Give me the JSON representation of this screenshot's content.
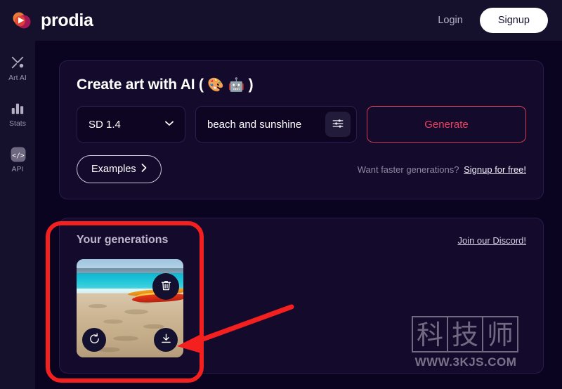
{
  "header": {
    "brand": "prodia",
    "logo_icon": "prodia-play-logo-icon",
    "login_label": "Login",
    "signup_label": "Signup"
  },
  "sidebar": {
    "items": [
      {
        "label": "Art AI",
        "icon": "brush-pen-icon"
      },
      {
        "label": "Stats",
        "icon": "bar-chart-icon"
      },
      {
        "label": "API",
        "icon": "code-brackets-icon"
      }
    ]
  },
  "create_card": {
    "title": "Create art with AI (",
    "title_end": ")",
    "emoji_palette": "🎨",
    "emoji_robot": "🤖",
    "model_select": {
      "value": "SD 1.4",
      "chevron_icon": "chevron-down-icon"
    },
    "prompt": {
      "value": "beach and sunshine",
      "placeholder": "beach and sunshine"
    },
    "settings_icon": "sliders-icon",
    "generate_label": "Generate",
    "examples_label": "Examples",
    "examples_chevron": "›",
    "faster_text": "Want faster generations?",
    "faster_link": "Signup for free!"
  },
  "generations": {
    "title": "Your generations",
    "discord_link": "Join our Discord!",
    "image_alt": "beach and sunshine",
    "actions": {
      "delete_icon": "trash-icon",
      "regenerate_icon": "refresh-icon",
      "download_icon": "download-icon"
    }
  },
  "watermark": {
    "chars": [
      "科",
      "技",
      "师"
    ],
    "url": "WWW.3KJS.COM"
  },
  "annotations": {
    "highlight_color": "#f42020",
    "arrow_color": "#f42020",
    "box_target": "Your generations panel",
    "arrow_target": "download-button"
  },
  "colors": {
    "page_bg": "#0a0420",
    "chrome_bg": "#15102b",
    "card_bg": "#140a2b",
    "accent_red": "#ef4060",
    "annotation_red": "#f42020"
  }
}
